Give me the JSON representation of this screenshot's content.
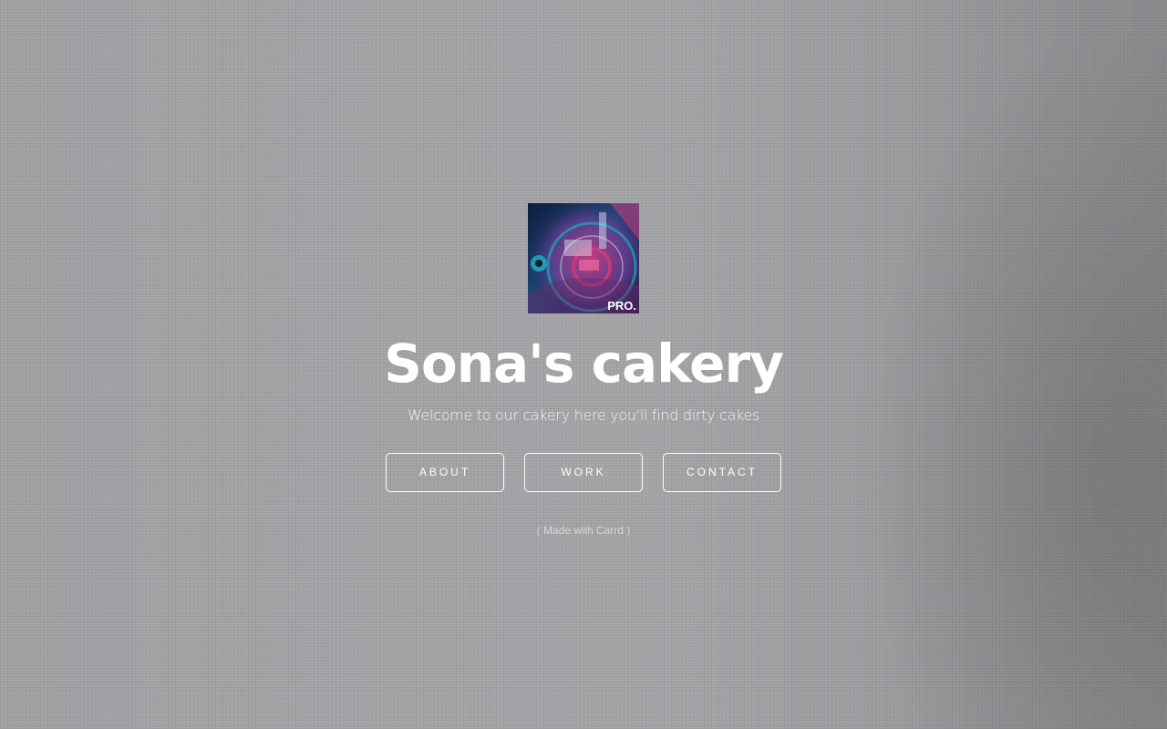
{
  "page": {
    "logo": {
      "alt_label": "PRO.",
      "colors": [
        "#1a4a7a",
        "#1fa6b8",
        "#d63a7c",
        "#8a3fa8",
        "#0c1c3a"
      ]
    },
    "title": "Sona's cakery",
    "subtitle": "Welcome to our cakery here you'll find dirty cakes",
    "nav": {
      "about": "ABOUT",
      "work": "WORK",
      "contact": "CONTACT"
    },
    "footer": {
      "open_paren": "(",
      "made_with": "Made with Carrd",
      "close_paren": ")"
    }
  },
  "colors": {
    "background": "#a7a7aa",
    "text": "#ffffff",
    "button_border": "#ffffff"
  }
}
